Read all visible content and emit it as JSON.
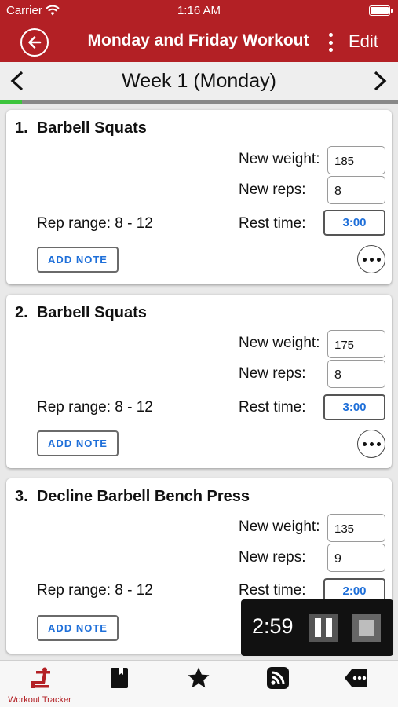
{
  "status_bar": {
    "carrier": "Carrier",
    "time": "1:16 AM"
  },
  "nav": {
    "title": "Monday and Friday Workout",
    "edit_label": "Edit",
    "back_icon": "back-arrow-circle-icon"
  },
  "week": {
    "title": "Week 1 (Monday)",
    "progress_fraction": 0.055
  },
  "labels": {
    "new_weight": "New weight:",
    "new_reps": "New reps:",
    "rest_time": "Rest time:",
    "add_note": "Add Note"
  },
  "exercises": [
    {
      "number": "1.",
      "name": "Barbell Squats",
      "weight": "185",
      "reps": "8",
      "rep_range": "Rep range: 8 - 12",
      "rest": "3:00"
    },
    {
      "number": "2.",
      "name": "Barbell Squats",
      "weight": "175",
      "reps": "8",
      "rep_range": "Rep range: 8 - 12",
      "rest": "3:00"
    },
    {
      "number": "3.",
      "name": "Decline Barbell Bench Press",
      "weight": "135",
      "reps": "9",
      "rep_range": "Rep range: 8 - 12",
      "rest": "2:00"
    }
  ],
  "timer": {
    "remaining": "2:59"
  },
  "tabs": [
    {
      "label": "Workout Tracker",
      "icon": "workout-tracker-icon",
      "active": true
    },
    {
      "label": "",
      "icon": "book-icon",
      "active": false
    },
    {
      "label": "",
      "icon": "star-icon",
      "active": false
    },
    {
      "label": "",
      "icon": "rss-feed-icon",
      "active": false
    },
    {
      "label": "",
      "icon": "more-tag-icon",
      "active": false
    }
  ],
  "colors": {
    "brand_red": "#b32025",
    "link_blue": "#1e6fd9",
    "progress_green": "#3cc43c"
  }
}
